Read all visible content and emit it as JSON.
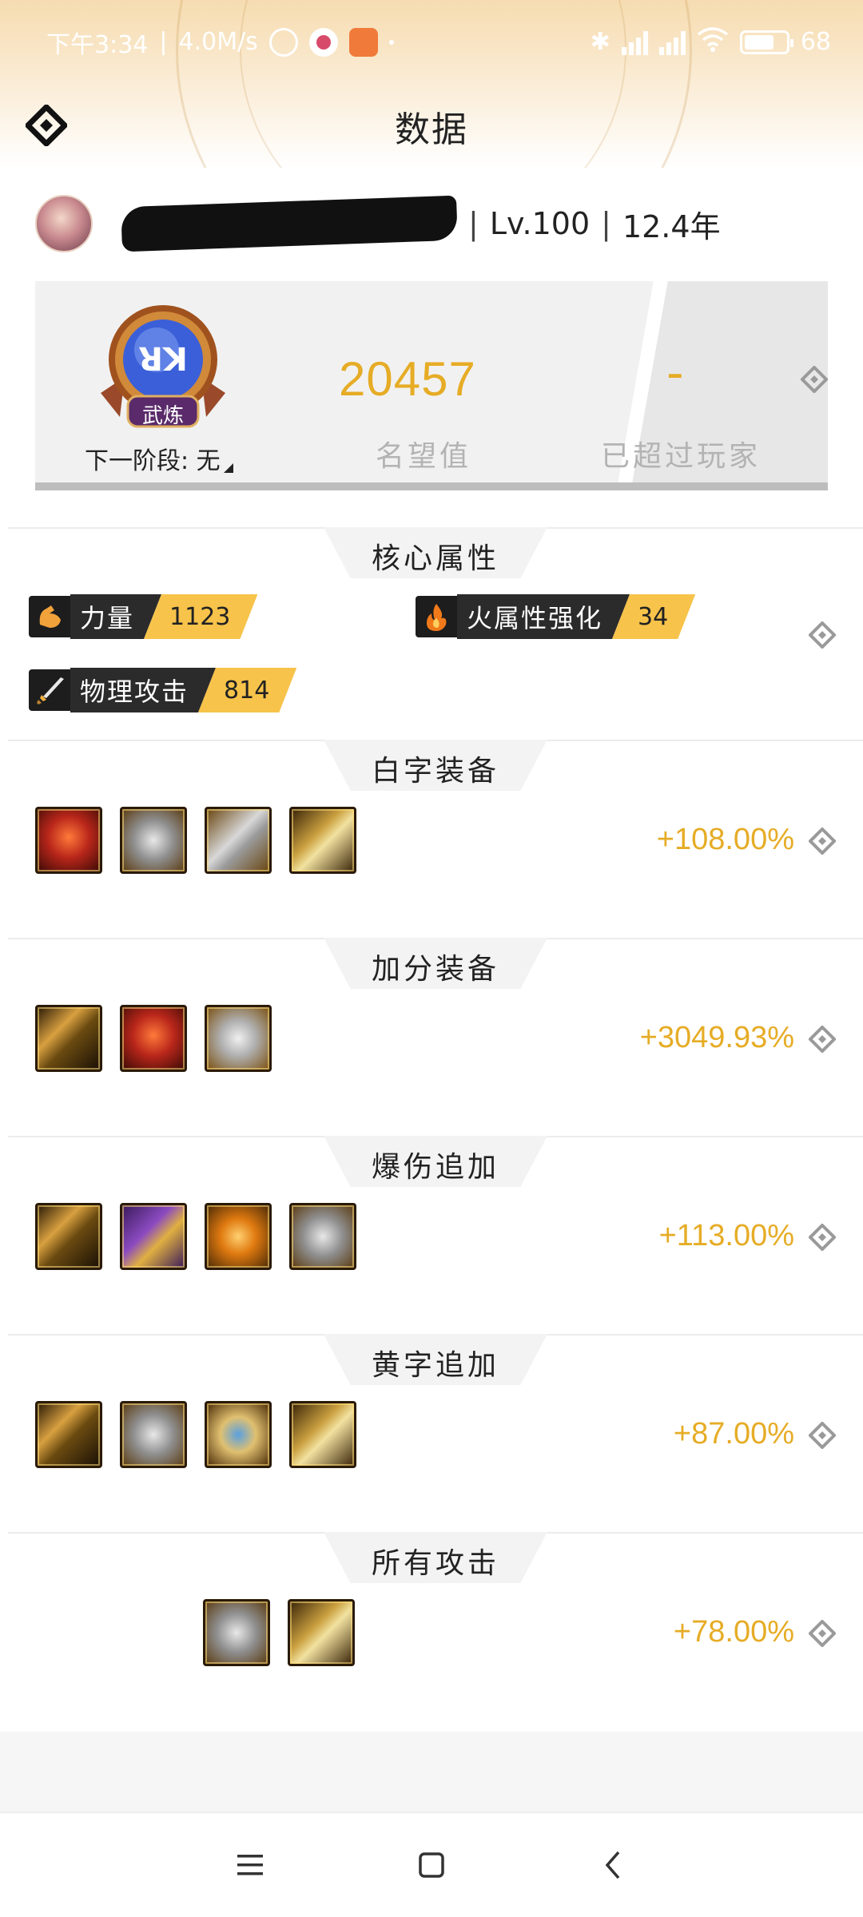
{
  "status_bar": {
    "time": "下午3:34",
    "speed": "4.0M/s",
    "battery": "68"
  },
  "header": {
    "title": "数据"
  },
  "profile": {
    "level": "Lv.100",
    "years": "12.4年"
  },
  "fame_card": {
    "badge_text": "武炼",
    "next_stage": "下一阶段: 无",
    "fame_value": "20457",
    "fame_label": "名望值",
    "rank_value": "-",
    "rank_label": "已超过玩家"
  },
  "core": {
    "title": "核心属性",
    "attributes": [
      {
        "name": "力量",
        "value": "1123",
        "icon": "strength-icon"
      },
      {
        "name": "火属性强化",
        "value": "34",
        "icon": "fire-element-icon"
      },
      {
        "name": "物理攻击",
        "value": "814",
        "icon": "physical-attack-icon"
      }
    ]
  },
  "sections": [
    {
      "title": "白字装备",
      "value": "+108.00%",
      "items": [
        "mask",
        "armor",
        "boots",
        "quill"
      ]
    },
    {
      "title": "加分装备",
      "value": "+3049.93%",
      "items": [
        "sword",
        "mask",
        "crystal"
      ]
    },
    {
      "title": "爆伤追加",
      "value": "+113.00%",
      "items": [
        "sword",
        "amulet",
        "orb",
        "armor"
      ]
    },
    {
      "title": "黄字追加",
      "value": "+87.00%",
      "items": [
        "sword",
        "armor",
        "ring",
        "quill"
      ]
    },
    {
      "title": "所有攻击",
      "value": "+78.00%",
      "items": [
        "armor",
        "armor"
      ]
    }
  ],
  "colors": {
    "accent_gold": "#e6ac26",
    "tag_yellow": "#f7c34a",
    "tag_dark": "#2b2b2b"
  }
}
